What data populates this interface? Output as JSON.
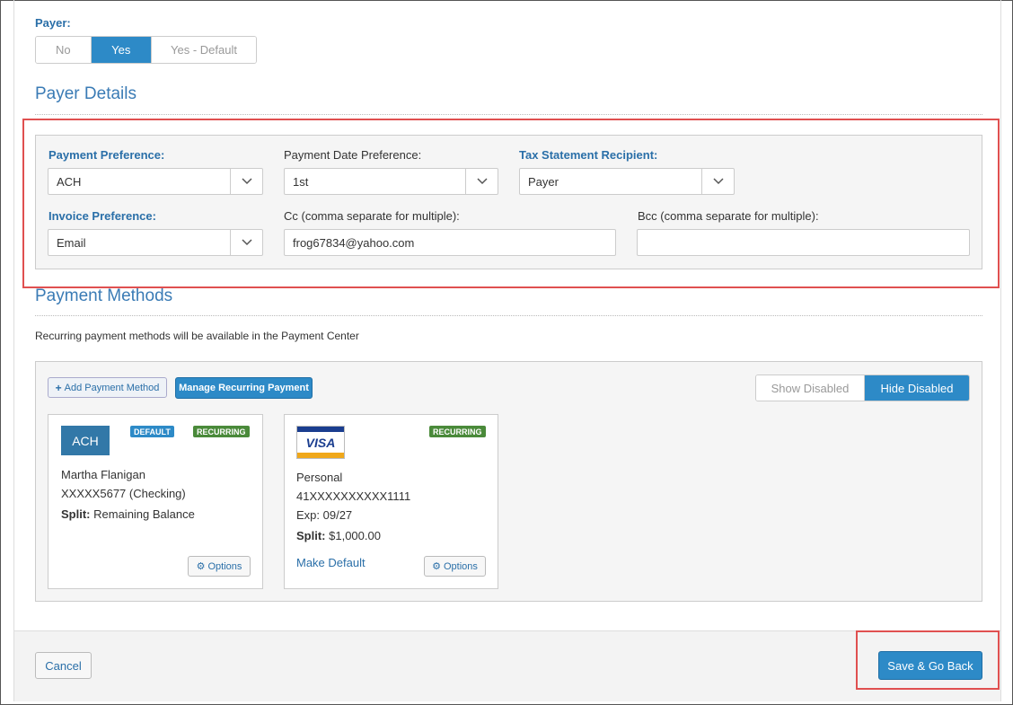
{
  "payer": {
    "label": "Payer:",
    "options": [
      "No",
      "Yes",
      "Yes - Default"
    ],
    "selected": "Yes"
  },
  "payer_details": {
    "title": "Payer Details",
    "payment_preference": {
      "label": "Payment Preference:",
      "value": "ACH"
    },
    "payment_date_preference": {
      "label": "Payment Date Preference:",
      "value": "1st"
    },
    "tax_statement_recipient": {
      "label": "Tax Statement Recipient:",
      "value": "Payer"
    },
    "invoice_preference": {
      "label": "Invoice Preference:",
      "value": "Email"
    },
    "cc": {
      "label": "Cc (comma separate for multiple):",
      "value": "frog67834@yahoo.com"
    },
    "bcc": {
      "label": "Bcc (comma separate for multiple):",
      "value": ""
    }
  },
  "payment_methods": {
    "title": "Payment Methods",
    "note": "Recurring payment methods will be available in the Payment Center",
    "add_button": "Add Payment Method",
    "manage_button": "Manage Recurring Payment",
    "toggle": {
      "show": "Show Disabled",
      "hide": "Hide Disabled",
      "selected": "Hide Disabled"
    },
    "cards": [
      {
        "type_label": "ACH",
        "badges": [
          "DEFAULT",
          "RECURRING"
        ],
        "name": "Martha Flanigan",
        "account": "XXXXX5677 (Checking)",
        "split_label": "Split:",
        "split_value": "Remaining Balance",
        "options_label": "Options"
      },
      {
        "type_label": "VISA",
        "badges": [
          "RECURRING"
        ],
        "name": "Personal",
        "account": "41XXXXXXXXXX1111",
        "exp": "Exp: 09/27",
        "split_label": "Split:",
        "split_value": "$1,000.00",
        "make_default": "Make Default",
        "options_label": "Options"
      }
    ]
  },
  "footer": {
    "cancel": "Cancel",
    "save": "Save & Go Back"
  },
  "colors": {
    "primary": "#2d8ac7",
    "highlight": "#e05050",
    "default_badge": "#2d8ac7",
    "recurring_badge": "#4a8a3a"
  }
}
